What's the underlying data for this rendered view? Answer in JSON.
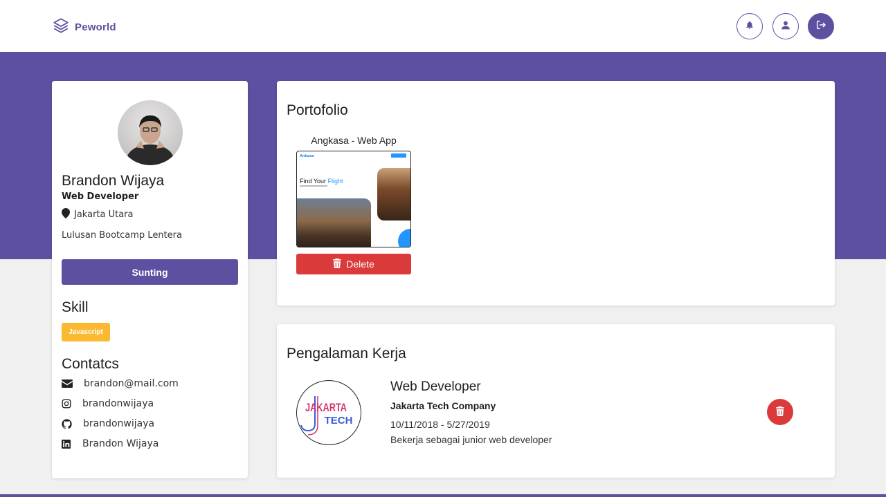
{
  "navbar": {
    "brand": "Peworld",
    "icons": [
      "bell-icon",
      "user-icon",
      "logout-icon"
    ],
    "accent_color": "#5e50a1"
  },
  "profile": {
    "name": "Brandon Wijaya",
    "job": "Web Developer",
    "location": "Jakarta Utara",
    "bio": "Lulusan Bootcamp Lentera",
    "edit_label": "Sunting",
    "skill_title": "Skill",
    "skills": [
      "Javascript"
    ],
    "contact_title": "Contatcs",
    "contacts": [
      {
        "icon": "mail-icon",
        "value": "brandon@mail.com"
      },
      {
        "icon": "instagram-icon",
        "value": "brandonwijaya"
      },
      {
        "icon": "github-icon",
        "value": "brandonwijaya"
      },
      {
        "icon": "linkedin-icon",
        "value": "Brandon Wijaya"
      }
    ]
  },
  "portfolio": {
    "title": "Portofolio",
    "items": [
      {
        "name": "Angkasa - Web App",
        "preview_brand": "Ankasa",
        "preview_headline": "Find Your",
        "preview_headline_accent": "Flight",
        "delete_label": "Delete"
      }
    ]
  },
  "experience": {
    "title": "Pengalaman Kerja",
    "items": [
      {
        "logo_text_1": "JAKARTA",
        "logo_text_2": "TECH",
        "position": "Web Developer",
        "company": "Jakarta Tech Company",
        "date": "10/11/2018 - 5/27/2019",
        "description": "Bekerja sebagai junior web developer"
      }
    ]
  },
  "colors": {
    "primary": "#5e50a1",
    "danger": "#da3a3a",
    "skill_badge": "#fbb931"
  }
}
